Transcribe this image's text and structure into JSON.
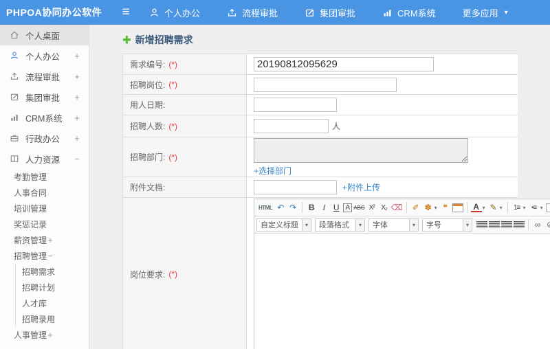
{
  "header": {
    "logo": "PHPOA协同办公软件",
    "menu_icon": "≡",
    "nav": [
      {
        "name": "nav-personal-office",
        "label": "个人办公",
        "icon": "i-user"
      },
      {
        "name": "nav-workflow-approval",
        "label": "流程审批",
        "icon": "i-share"
      },
      {
        "name": "nav-group-approval",
        "label": "集团审批",
        "icon": "i-edit"
      },
      {
        "name": "nav-crm-system",
        "label": "CRM系统",
        "icon": "i-chart"
      },
      {
        "name": "nav-more-apps",
        "label": "更多应用",
        "caret": "▾"
      }
    ]
  },
  "sidebar": {
    "items": [
      {
        "name": "sidebar-item-desktop",
        "label": "个人桌面",
        "icon": "i-home",
        "expand": "",
        "active": true
      },
      {
        "name": "sidebar-item-personal-office",
        "label": "个人办公",
        "icon": "i-user",
        "icon_color": "#4a90e2",
        "expand": "+"
      },
      {
        "name": "sidebar-item-workflow-approval",
        "label": "流程审批",
        "icon": "i-share",
        "expand": "+"
      },
      {
        "name": "sidebar-item-group-approval",
        "label": "集团审批",
        "icon": "i-edit",
        "expand": "+"
      },
      {
        "name": "sidebar-item-crm-system",
        "label": "CRM系统",
        "icon": "i-chart",
        "expand": "+"
      },
      {
        "name": "sidebar-item-admin-office",
        "label": "行政办公",
        "icon": "i-brief",
        "expand": "+"
      },
      {
        "name": "sidebar-item-human-resources",
        "label": "人力资源",
        "icon": "i-book",
        "expand": "−"
      }
    ],
    "hr_children": [
      {
        "name": "sidebar-item-attendance",
        "label": "考勤管理",
        "expand": ""
      },
      {
        "name": "sidebar-item-hr-contract",
        "label": "人事合同",
        "expand": ""
      },
      {
        "name": "sidebar-item-training",
        "label": "培训管理",
        "expand": ""
      },
      {
        "name": "sidebar-item-reward-punish",
        "label": "奖惩记录",
        "expand": ""
      },
      {
        "name": "sidebar-item-salary",
        "label": "薪资管理",
        "expand": "+"
      },
      {
        "name": "sidebar-item-recruit-mgmt",
        "label": "招聘管理",
        "expand": "−"
      }
    ],
    "recruit_children": [
      {
        "name": "sidebar-item-recruit-demand",
        "label": "招聘需求"
      },
      {
        "name": "sidebar-item-recruit-plan",
        "label": "招聘计划"
      },
      {
        "name": "sidebar-item-talent-pool",
        "label": "人才库"
      },
      {
        "name": "sidebar-item-recruit-hire",
        "label": "招聘录用"
      }
    ],
    "tail_items": [
      {
        "name": "sidebar-item-hr-management",
        "label": "人事管理",
        "expand": "+"
      }
    ]
  },
  "main": {
    "title": "新增招聘需求",
    "title_icon": "✚",
    "form": {
      "required_mark": "(*)",
      "rows": {
        "code": {
          "label": "需求编号:",
          "value": "20190812095629"
        },
        "position": {
          "label": "招聘岗位:"
        },
        "date": {
          "label": "用人日期:"
        },
        "count": {
          "label": "招聘人数:",
          "suffix": "人"
        },
        "dept": {
          "label": "招聘部门:",
          "link": "+选择部门"
        },
        "attach": {
          "label": "附件文档:",
          "link": "+附件上传"
        },
        "requirement": {
          "label": "岗位要求:"
        }
      }
    },
    "editor": {
      "toolbar1": [
        {
          "name": "html-source-button",
          "glyph": "HTML",
          "cls": "chip"
        },
        {
          "name": "undo-icon",
          "glyph": "↶",
          "color": "#2e72bd"
        },
        {
          "name": "redo-icon",
          "glyph": "↷",
          "color": "#2e72bd"
        },
        {
          "sep": true
        },
        {
          "name": "bold-icon",
          "glyph": "B",
          "cls": "b"
        },
        {
          "name": "italic-icon",
          "glyph": "I",
          "cls": "i"
        },
        {
          "name": "underline-icon",
          "glyph": "U",
          "cls": "u"
        },
        {
          "name": "font-border-icon",
          "glyph": "A",
          "cls": "boxed"
        },
        {
          "name": "strikethrough-icon",
          "glyph": "ABC",
          "cls": "strike"
        },
        {
          "name": "superscript-icon",
          "glyph": "X²",
          "cls": "sm"
        },
        {
          "name": "subscript-icon",
          "glyph": "X₂",
          "cls": "sm"
        },
        {
          "name": "eraser-icon",
          "glyph": "⌫",
          "color": "#cc6677"
        },
        {
          "sep": true
        },
        {
          "name": "format-painter-icon",
          "glyph": "✐",
          "color": "#c8790b"
        },
        {
          "name": "auto-typeset-icon",
          "glyph": "✽",
          "color": "#c8790b"
        },
        {
          "name": "auto-typeset-caret",
          "glyph": "▾",
          "cls": "caret"
        },
        {
          "name": "blockquote-icon",
          "glyph": "❝",
          "color": "#c8790b"
        },
        {
          "name": "paste-plain-icon",
          "cls": "ico-cal"
        },
        {
          "sep": true
        },
        {
          "name": "font-color-icon",
          "glyph": "A",
          "cls": "fc"
        },
        {
          "name": "font-color-caret",
          "glyph": "▾",
          "cls": "caret"
        },
        {
          "name": "highlight-icon",
          "glyph": "✎",
          "color": "#996611"
        },
        {
          "name": "highlight-caret",
          "glyph": "▾",
          "cls": "caret"
        },
        {
          "sep": true
        },
        {
          "name": "ordered-list-icon",
          "glyph": "1≡",
          "cls": "sm"
        },
        {
          "name": "ordered-list-caret",
          "glyph": "▾",
          "cls": "caret"
        },
        {
          "name": "unordered-list-icon",
          "glyph": "•≡",
          "cls": "sm"
        },
        {
          "name": "unordered-list-caret",
          "glyph": "▾",
          "cls": "caret"
        },
        {
          "name": "new-page-icon",
          "cls": "ico-doc"
        },
        {
          "sep": true
        },
        {
          "name": "map-icon",
          "cls": "ico-blue"
        }
      ],
      "toolbar2_dropdowns": [
        {
          "name": "heading-select",
          "label": "自定义标题"
        },
        {
          "name": "paragraph-format-select",
          "label": "段落格式"
        },
        {
          "name": "font-family-select",
          "label": "字体"
        },
        {
          "name": "font-size-select",
          "label": "字号"
        }
      ],
      "toolbar2_icons": [
        {
          "name": "align-left-icon",
          "cls": "ico-al"
        },
        {
          "name": "align-center-icon",
          "cls": "ico-al"
        },
        {
          "name": "align-right-icon",
          "cls": "ico-al"
        },
        {
          "name": "align-justify-icon",
          "cls": "ico-al"
        },
        {
          "sep": true
        },
        {
          "name": "link-icon",
          "glyph": "∞",
          "color": "#666666"
        },
        {
          "name": "unlink-icon",
          "glyph": "⊘",
          "color": "#666666"
        },
        {
          "name": "image-icon",
          "cls": "ico-img"
        },
        {
          "name": "image-upload-icon",
          "cls": "ico-img up"
        },
        {
          "name": "insert-frame-icon",
          "cls": "ico-colblue"
        },
        {
          "name": "table-icon",
          "cls": "ico-table"
        }
      ]
    }
  },
  "colors": {
    "header_bg": "#4a94e4",
    "accent_green": "#5cb832",
    "link_blue": "#3b87c9",
    "required_red": "#e43c3c",
    "active_item_bg": "#e4e4e4"
  }
}
